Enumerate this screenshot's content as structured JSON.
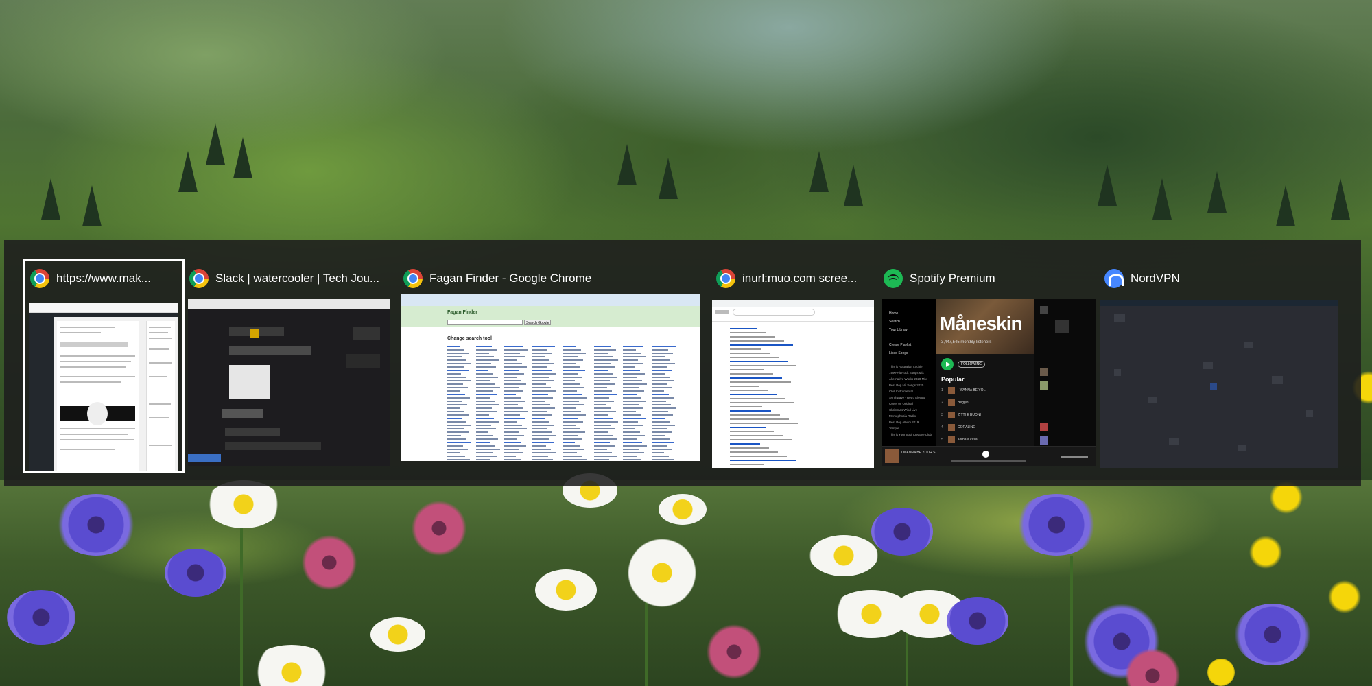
{
  "desktop": {
    "wallpaper": "alpine-meadow-with-wildflowers"
  },
  "switcher": {
    "windows": [
      {
        "title": "https://www.mak...",
        "icon": "chrome-icon",
        "selected": true
      },
      {
        "title": "Slack | watercooler | Tech Jou...",
        "icon": "chrome-icon",
        "selected": false
      },
      {
        "title": "Fagan Finder - Google Chrome",
        "icon": "chrome-icon",
        "selected": false
      },
      {
        "title": "inurl:muo.com scree...",
        "icon": "chrome-icon",
        "selected": false
      },
      {
        "title": "Spotify Premium",
        "icon": "spotify-icon",
        "selected": false
      },
      {
        "title": "NordVPN",
        "icon": "nordvpn-icon",
        "selected": false
      }
    ]
  },
  "thumbnails": {
    "fagan": {
      "site_title": "Fagan Finder",
      "heading": "Change search tool",
      "search_button": "Search Google"
    },
    "spotify": {
      "nav": [
        "Home",
        "Search",
        "Your Library"
      ],
      "library": [
        "Create Playlist",
        "Liked Songs"
      ],
      "playlists": [
        "This is Australian Lochie",
        "1990-Hit Rock Songs Mix",
        "Alternative Works 2020 Mix",
        "Best Pop Hit Songs 2020",
        "Chill Instrumental",
        "Synthwave - Retro Electro",
        "Cover on Original",
        "Christmas Wind Live",
        "Memephobia Radio",
        "Best Pop Album 2019",
        "Temple",
        "This is Your Soul Creative Club"
      ],
      "artist": "Måneskin",
      "listeners": "3,447,545 monthly listeners",
      "follow": "FOLLOWING",
      "popular": "Popular",
      "tracks": [
        "I WANNA BE YO...",
        "Beggin'",
        "ZITTI E BUONI",
        "CORALINE",
        "Torna a casa"
      ],
      "now_playing": "I WANNA BE YOUR S..."
    }
  },
  "colors": {
    "switcher_bg": "#1e1e1e",
    "selection_border": "#ffffff",
    "spotify_green": "#1db954",
    "nord_blue": "#4687ff"
  }
}
